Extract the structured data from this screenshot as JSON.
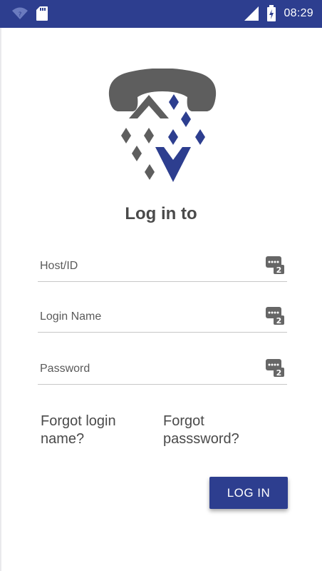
{
  "status_bar": {
    "time": "08:29",
    "icons": [
      "wifi-question-icon",
      "sd-card-icon",
      "signal-icon",
      "battery-charging-icon"
    ]
  },
  "app": {
    "logo": "phone-diamond-logo",
    "title": "Log in to"
  },
  "form": {
    "host": {
      "placeholder": "Host/ID",
      "value": "",
      "icon": "password-manager-icon"
    },
    "login_name": {
      "placeholder": "Login Name",
      "value": "",
      "icon": "password-manager-icon"
    },
    "password": {
      "placeholder": "Password",
      "value": "",
      "icon": "password-manager-icon"
    }
  },
  "links": {
    "forgot_login_line1": "Forgot login",
    "forgot_login_line2": "name?",
    "forgot_password_line1": "Forgot",
    "forgot_password_line2": "passsword?"
  },
  "buttons": {
    "login": "LOG IN"
  },
  "colors": {
    "primary": "#2d3e8f",
    "logo_gray": "#5e5e5e",
    "text": "#4a4a4a"
  }
}
